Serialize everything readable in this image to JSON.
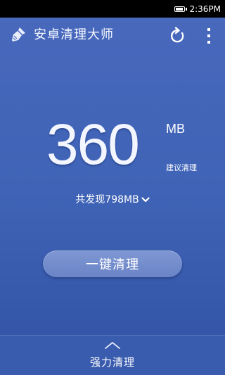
{
  "status_bar": {
    "time": "2:36PM",
    "battery_icon": "battery-icon"
  },
  "app_bar": {
    "title": "安卓清理大师",
    "logo_icon": "broom-icon",
    "refresh_icon": "refresh-icon",
    "more_icon": "more-vertical-icon"
  },
  "summary": {
    "junk_size": "360",
    "unit": "MB",
    "suggest_label": "建议清理",
    "found_label": "共发现798MB",
    "found_chevron_icon": "chevron-down-icon"
  },
  "actions": {
    "one_click_clean": "一键清理"
  },
  "bottom_panel": {
    "label": "强力清理",
    "expand_icon": "chevron-up-icon"
  },
  "colors": {
    "background": "#3f63b4",
    "button": "#728bcb",
    "status_bar": "#000000"
  }
}
